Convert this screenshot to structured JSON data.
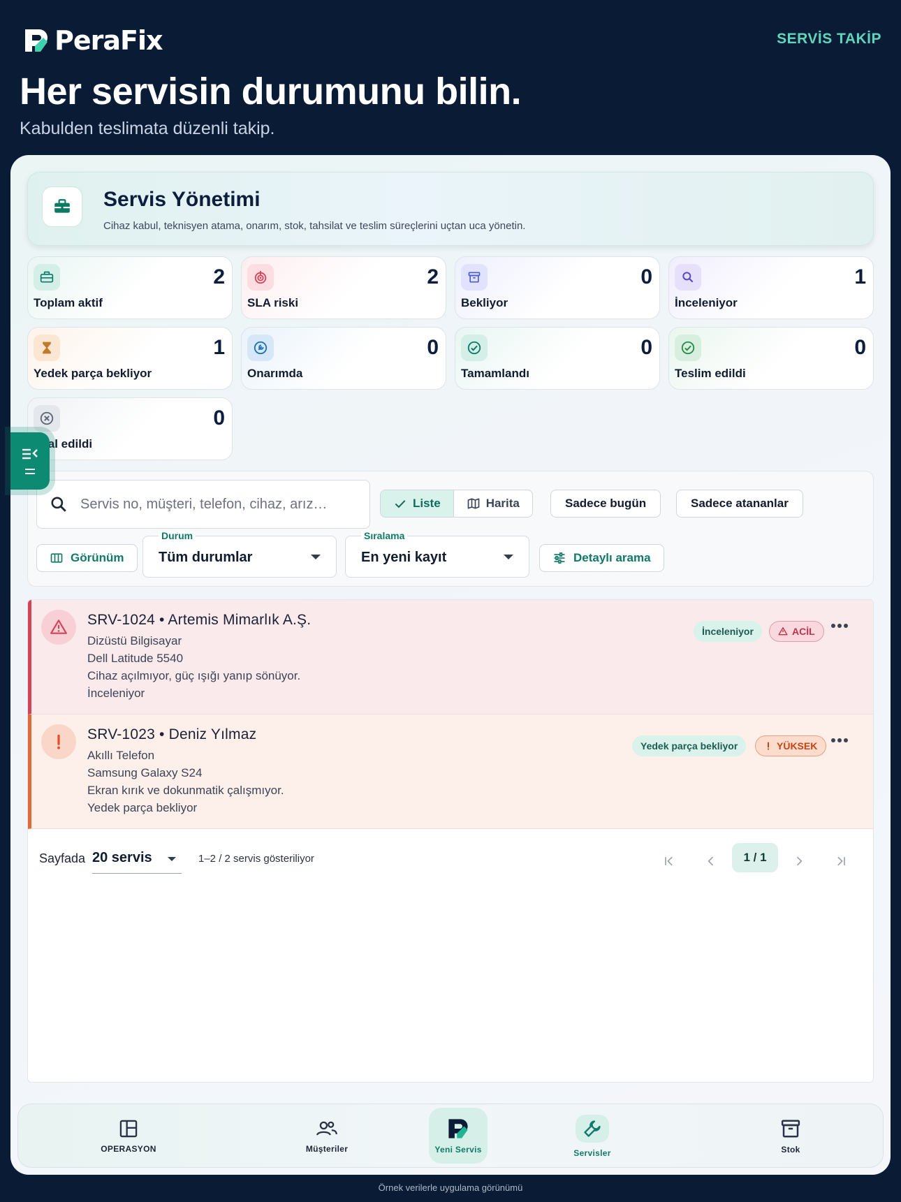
{
  "header": {
    "brand": "PeraFix",
    "tag": "SERVİS TAKİP",
    "title": "Her servisin durumunu bilin.",
    "subtitle": "Kabulden teslimata düzenli takip."
  },
  "banner": {
    "title": "Servis Yönetimi",
    "subtitle": "Cihaz kabul, teknisyen atama, onarım, stok, tahsilat ve teslim süreçlerini uçtan uca yönetin."
  },
  "stats": [
    {
      "label": "Toplam aktif",
      "value": "2",
      "icon": "briefcase-icon"
    },
    {
      "label": "SLA riski",
      "value": "2",
      "icon": "target-icon"
    },
    {
      "label": "Bekliyor",
      "value": "0",
      "icon": "archive-icon"
    },
    {
      "label": "İnceleniyor",
      "value": "1",
      "icon": "search-icon"
    },
    {
      "label": "Yedek parça bekliyor",
      "value": "1",
      "icon": "hourglass-icon"
    },
    {
      "label": "Onarımda",
      "value": "0",
      "icon": "wrench-icon"
    },
    {
      "label": "Tamamlandı",
      "value": "0",
      "icon": "check-circle-icon"
    },
    {
      "label": "Teslim edildi",
      "value": "0",
      "icon": "check-circle-icon"
    },
    {
      "label": "İptal edildi",
      "value": "0",
      "icon": "cancel-circle-icon"
    }
  ],
  "filters": {
    "search_placeholder": "Servis no, müşteri, telefon, cihaz, arız…",
    "view_list": "Liste",
    "view_map": "Harita",
    "only_today": "Sadece bugün",
    "only_assigned": "Sadece atananlar",
    "columns": "Görünüm",
    "status_label": "Durum",
    "status_value": "Tüm durumlar",
    "sort_label": "Sıralama",
    "sort_value": "En yeni kayıt",
    "advanced": "Detaylı arama"
  },
  "services": [
    {
      "title": "SRV-1024 • Artemis Mimarlık A.Ş.",
      "device": "Dizüstü Bilgisayar",
      "model": "Dell Latitude 5540",
      "issue": "Cihaz açılmıyor, güç ışığı yanıp sönüyor.",
      "status": "İnceleniyor",
      "status_badge": "İnceleniyor",
      "priority": "ACİL",
      "priority_icon": "warning-triangle-icon"
    },
    {
      "title": "SRV-1023 • Deniz Yılmaz",
      "device": "Akıllı Telefon",
      "model": "Samsung Galaxy S24",
      "issue": "Ekran kırık ve dokunmatik çalışmıyor.",
      "status": "Yedek parça bekliyor",
      "status_badge": "Yedek parça bekliyor",
      "priority": "YÜKSEK",
      "priority_icon": "exclamation-icon"
    }
  ],
  "pager": {
    "per_page_label": "Sayfada",
    "per_page_value": "20 servis",
    "count": "1–2 / 2 servis gösteriliyor",
    "page": "1 / 1"
  },
  "nav": {
    "operations": "OPERASYON",
    "customers": "Müşteriler",
    "new_service": "Yeni Servis",
    "services": "Servisler",
    "stock": "Stok"
  },
  "footer": "Örnek verilerle uygulama görünümü",
  "colors": {
    "background": "#0a1b35",
    "accent": "#0d8a72",
    "urgent": "#d0455a",
    "high": "#e26a3a"
  }
}
